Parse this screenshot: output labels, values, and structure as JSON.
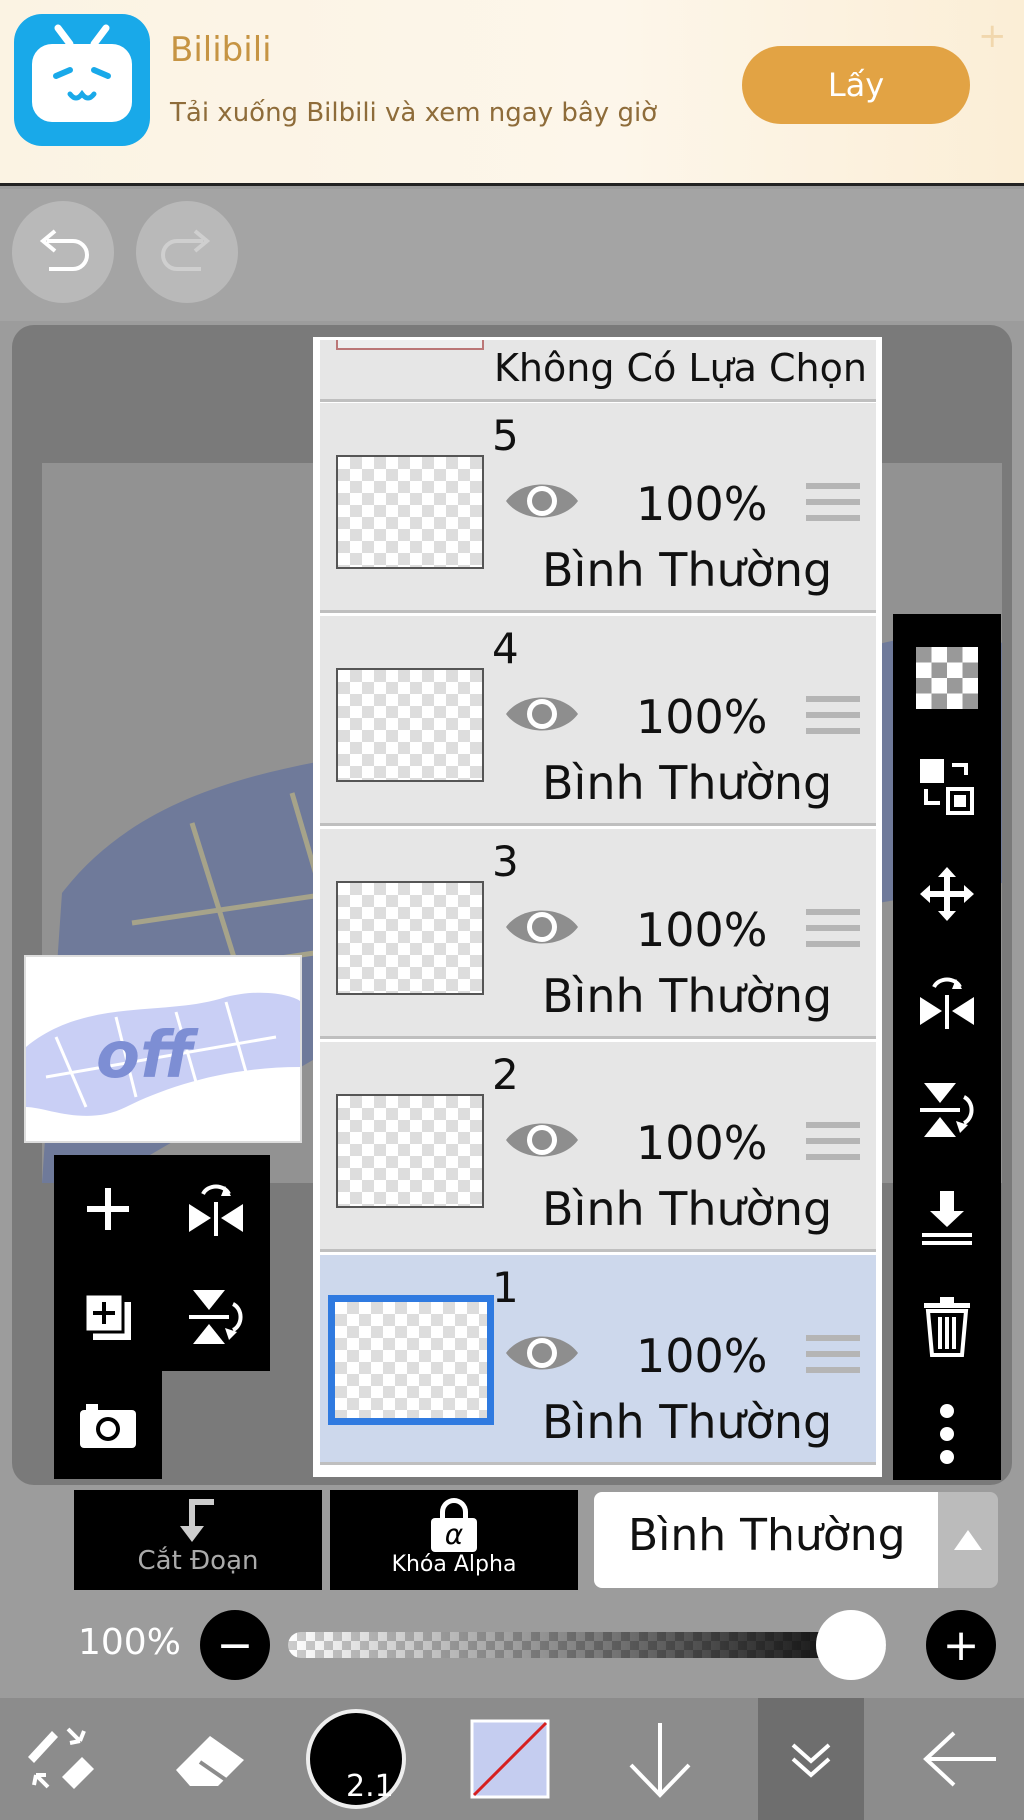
{
  "ad": {
    "title": "Bilibili",
    "subtitle": "Tải xuống Bilbili và xem ngay bây giờ",
    "button_label": "Lấy"
  },
  "layers_panel": {
    "selection_label": "Không Có Lựa Chọn",
    "layers": [
      {
        "number": "5",
        "opacity": "100%",
        "blend_mode": "Bình Thường",
        "visible": true,
        "selected": false
      },
      {
        "number": "4",
        "opacity": "100%",
        "blend_mode": "Bình Thường",
        "visible": true,
        "selected": false
      },
      {
        "number": "3",
        "opacity": "100%",
        "blend_mode": "Bình Thường",
        "visible": true,
        "selected": false
      },
      {
        "number": "2",
        "opacity": "100%",
        "blend_mode": "Bình Thường",
        "visible": true,
        "selected": false
      },
      {
        "number": "1",
        "opacity": "100%",
        "blend_mode": "Bình Thường",
        "visible": true,
        "selected": true
      }
    ]
  },
  "layer_controls": {
    "clipping_label": "Cắt Đoạn",
    "alpha_lock_label": "Khóa Alpha",
    "alpha_symbol": "α",
    "blend_mode": "Bình Thường",
    "opacity_label": "100%",
    "opacity_value": 1.0
  },
  "bottom_toolbar": {
    "brush_size": "2.1",
    "current_color": "#c5cdf0"
  },
  "colors": {
    "selection_highlight": "#2f7ae0",
    "selected_layer_bg": "#cdd8ec",
    "ad_button": "#e2a344"
  },
  "icons": [
    "undo-icon",
    "redo-icon",
    "eye-icon",
    "drag-handle-icon",
    "checker-icon",
    "transform-select-icon",
    "move-icon",
    "flip-horizontal-icon",
    "flip-vertical-icon",
    "merge-down-icon",
    "trash-icon",
    "more-icon",
    "add-layer-icon",
    "duplicate-layer-icon",
    "camera-icon",
    "brush-icon",
    "eraser-icon",
    "arrow-down-icon",
    "chevron-double-down-icon",
    "back-arrow-icon"
  ]
}
